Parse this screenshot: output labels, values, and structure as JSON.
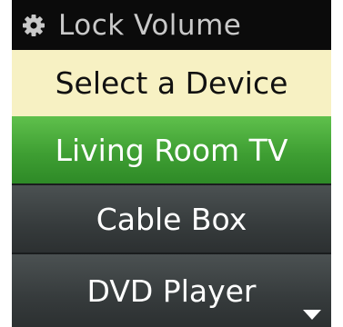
{
  "title_bar": {
    "icon": "gear-icon",
    "title": "Lock Volume"
  },
  "header": {
    "label": "Select a Device"
  },
  "devices": [
    {
      "label": "Living Room TV",
      "selected": true
    },
    {
      "label": "Cable Box",
      "selected": false
    },
    {
      "label": "DVD Player",
      "selected": false
    }
  ],
  "scroll_indicator": {
    "icon": "scroll-down-arrow-icon"
  },
  "colors": {
    "header_bg": "#f7f1c3",
    "selected_bg": "#4cae3d",
    "item_bg": "#3a3f40"
  }
}
